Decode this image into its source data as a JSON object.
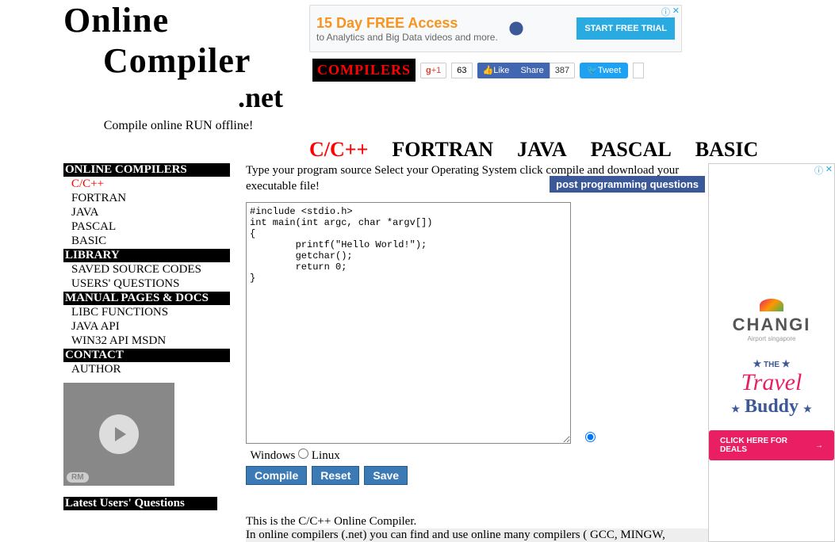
{
  "logo": {
    "line1": "Online",
    "line2": "Compiler",
    "line3": ".net"
  },
  "tagline": "Compile online RUN offline!",
  "top_ad": {
    "title": "15 Day FREE Access",
    "subtitle": "to Analytics and Big Data videos and more.",
    "button": "START FREE TRIAL"
  },
  "compilers_label": "COMPILERS",
  "social": {
    "gplus": "+1",
    "gplus_count": "63",
    "fb_like": "Like",
    "fb_share": "Share",
    "fb_count": "387",
    "tweet": "Tweet",
    "tweet_count": ""
  },
  "lang_nav": [
    "C/C++",
    "FORTRAN",
    "JAVA",
    "PASCAL",
    "BASIC"
  ],
  "sidebar": {
    "sections": [
      {
        "header": "ONLINE COMPILERS",
        "items": [
          "C/C++",
          "FORTRAN",
          "JAVA",
          "PASCAL",
          "BASIC"
        ]
      },
      {
        "header": "LIBRARY",
        "items": [
          "SAVED SOURCE CODES",
          "USERS' QUESTIONS"
        ]
      },
      {
        "header": "MANUAL PAGES & DOCS",
        "items": [
          "LIBC FUNCTIONS",
          "JAVA API",
          "WIN32 API MSDN"
        ]
      },
      {
        "header": "CONTACT",
        "items": [
          "AUTHOR"
        ]
      }
    ],
    "rm": "RM",
    "questions": "Latest Users' Questions"
  },
  "content": {
    "intro": "Type your program source Select your Operating System click compile and download your executable file!",
    "post_q": "post programming questions",
    "code": "#include <stdio.h>\nint main(int argc, char *argv[])\n{\n        printf(\"Hello World!\");\n        getchar();\n        return 0;\n}",
    "os": {
      "win": "Windows",
      "linux": "Linux"
    },
    "buttons": {
      "compile": "Compile",
      "reset": "Reset",
      "save": "Save"
    },
    "desc1": "This is the C/C++ Online Compiler.",
    "desc2": "In online compilers (.net) you can find and use online many compilers ( GCC, MINGW,"
  },
  "side_ad": {
    "brand": "CHANGI",
    "brand_sub": "Airport singapore",
    "the": "THE",
    "travel": "Travel",
    "buddy": "Buddy",
    "click": "CLICK HERE FOR DEALS"
  }
}
